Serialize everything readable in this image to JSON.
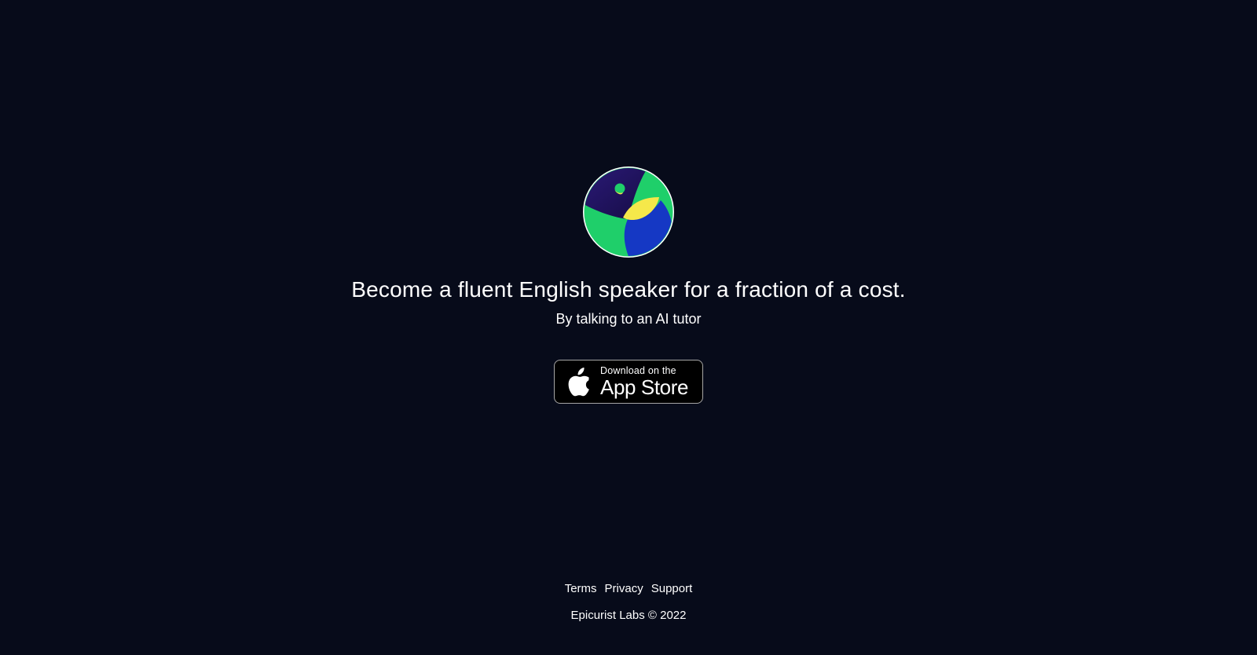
{
  "hero": {
    "logo_icon": "parrot-logo-icon",
    "headline": "Become a fluent English speaker for a fraction of a cost.",
    "subheadline": "By talking to an AI tutor"
  },
  "app_store_badge": {
    "icon": "apple-icon",
    "small_text": "Download on the",
    "big_text": "App Store"
  },
  "footer": {
    "links": [
      {
        "label": "Terms"
      },
      {
        "label": "Privacy"
      },
      {
        "label": "Support"
      }
    ],
    "copyright": "Epicurist Labs © 2022"
  },
  "colors": {
    "background": "#070b1a",
    "logo_purple": "#2a1470",
    "logo_green": "#1fcf6a",
    "logo_blue": "#1538c4",
    "logo_yellow": "#f5e84a"
  }
}
